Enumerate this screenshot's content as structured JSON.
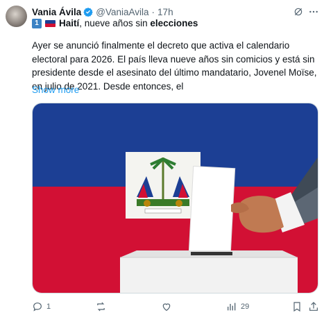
{
  "post": {
    "author_name": "Vania Ávila",
    "handle": "@VaniaAvila",
    "separator": "·",
    "time": "17h",
    "badge_num": "1",
    "headline_country": "Haití",
    "headline_middle": ", nueve años sin ",
    "headline_bold": "elecciones",
    "body": "Ayer se anunció finalmente el decreto que activa el calendario electoral para 2026. El país lleva nueve años sin comicios y está sin presidente desde el asesinato del último mandatario, Jovenel Moïse, en julio de 2021. Desde entonces, el",
    "show_more": "Show more"
  },
  "media": {
    "flag_blue": "#1c3f94",
    "flag_red": "#d21034",
    "ballot_color": "#ffffff",
    "box_color": "#f2f2f2"
  },
  "actions": {
    "replies": "1",
    "reposts": "",
    "likes": "",
    "views": "29"
  },
  "icons": [
    "verified-icon",
    "grok-icon",
    "more-icon",
    "reply-icon",
    "repost-icon",
    "like-icon",
    "views-icon",
    "bookmark-icon",
    "share-icon"
  ],
  "colors": {
    "accent": "#1d9bf0",
    "muted": "#536471"
  }
}
